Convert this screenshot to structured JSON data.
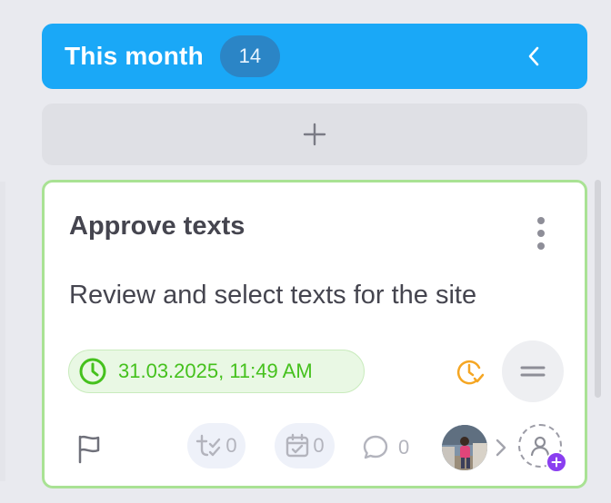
{
  "column": {
    "title": "This month",
    "count": "14",
    "accent_color": "#1aa8f7",
    "collapse_icon": "chevron-left-icon",
    "add_icon": "plus-icon"
  },
  "card": {
    "title": "Approve texts",
    "description": "Review and select texts for the site",
    "border_color": "#a9e294",
    "due": {
      "icon": "clock-icon",
      "text": "31.03.2025, 11:49 AM",
      "color": "#45c11d"
    },
    "timer_icon": "clock-check-icon",
    "timer_color": "#f5a623",
    "priority_icon": "equals-icon",
    "flag_icon": "flag-icon",
    "subtasks": {
      "icon": "checklist-icon",
      "count": "0"
    },
    "date_items": {
      "icon": "calendar-check-icon",
      "count": "0"
    },
    "comments": {
      "icon": "comment-icon",
      "count": "0"
    },
    "assignee_avatar": "avatar",
    "add_assignee_icon": "add-user-icon",
    "add_badge_color": "#8a3ef0"
  }
}
